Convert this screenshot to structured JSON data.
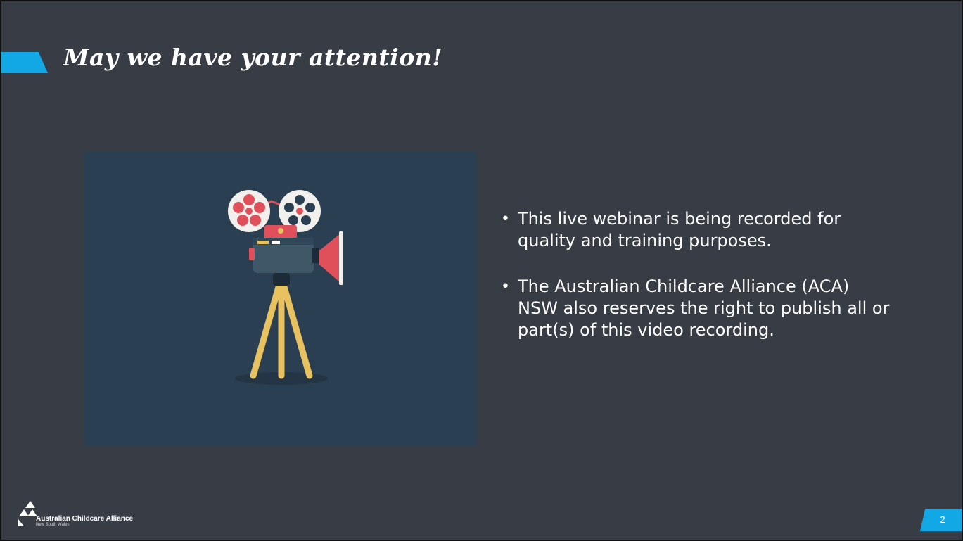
{
  "slide": {
    "title": "May we have your attention!",
    "bullets": [
      {
        "text": "This live webinar is being recorded for quality and training purposes."
      },
      {
        "text": "The Australian Childcare Alliance (ACA) NSW also reserves the right to publish all or part(s) of this video recording."
      }
    ],
    "bullet_glyph": "•",
    "page_number": "2"
  },
  "logo": {
    "name": "Australian Childcare Alliance",
    "subtitle": "New South Wales"
  },
  "icons": {
    "illustration": "film-camera-icon",
    "logo": "aca-logo-icon"
  },
  "colors": {
    "background": "#383c45",
    "accent": "#12a8e6",
    "illustration_bg": "#2b3f52",
    "text": "#ffffff"
  }
}
